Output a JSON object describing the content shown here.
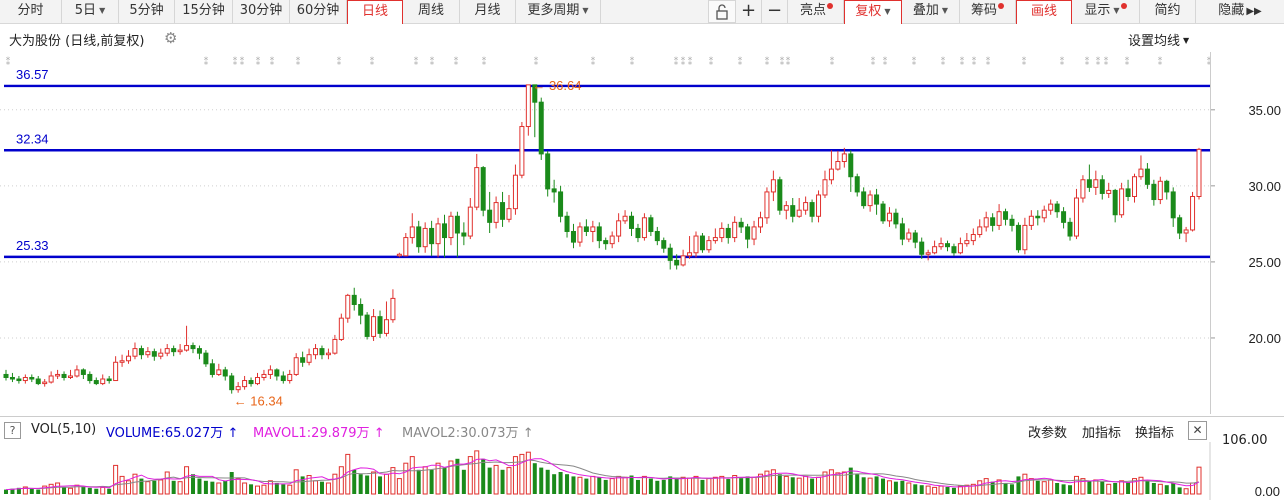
{
  "toolbar": {
    "tabs": [
      {
        "label": "分时"
      },
      {
        "label": "5日",
        "dropdown": true
      },
      {
        "label": "5分钟"
      },
      {
        "label": "15分钟"
      },
      {
        "label": "30分钟"
      },
      {
        "label": "60分钟"
      },
      {
        "label": "日线",
        "active": true
      },
      {
        "label": "周线"
      },
      {
        "label": "月线"
      },
      {
        "label": "更多周期",
        "dropdown": true
      }
    ],
    "tools": [
      {
        "label": "亮点",
        "dot": true
      },
      {
        "label": "复权",
        "dropdown": true
      },
      {
        "label": "叠加",
        "dropdown": true
      },
      {
        "label": "筹码",
        "dot": true
      },
      {
        "label": "画线"
      },
      {
        "label": "显示",
        "dropdown": true,
        "dot": true
      },
      {
        "label": "简约"
      },
      {
        "label": "隐藏"
      }
    ],
    "icons": [
      "lock-icon",
      "plus-icon",
      "minus-icon",
      "double-chevron-right-icon"
    ]
  },
  "header": {
    "title": "大为股份 (日线,前复权)",
    "ma_settings": "设置均线"
  },
  "price_axis": {
    "ticks": [
      "35.00",
      "30.00",
      "25.00",
      "20.00"
    ]
  },
  "hlines": [
    {
      "label": "36.57",
      "value": 36.57
    },
    {
      "label": "32.34",
      "value": 32.34
    },
    {
      "label": "25.33",
      "value": 25.33
    }
  ],
  "annotations": {
    "high": "← 36.64",
    "low": "← 16.34"
  },
  "volume": {
    "qmark": "?",
    "label": "VOL(5,10)",
    "volume": "VOLUME:65.027万",
    "mavol1": "MAVOL1:29.879万",
    "mavol2": "MAVOL2:30.073万",
    "axis_top": "106.00",
    "axis_bottom": "0.00",
    "links": [
      "改参数",
      "加指标",
      "换指标"
    ],
    "close": "✕"
  },
  "colors": {
    "up": "#e0312e",
    "down": "#1a8a1a",
    "hline": "#0000cc",
    "mavol1": "#e020e0",
    "mavol2": "#888888"
  },
  "chart_data": {
    "type": "candlestick",
    "ylim": [
      15,
      38.8
    ],
    "candles": [
      [
        17.6,
        17.4,
        17.9,
        17.2
      ],
      [
        17.4,
        17.3,
        17.7,
        17.1
      ],
      [
        17.3,
        17.2,
        17.5,
        17.0
      ],
      [
        17.2,
        17.4,
        17.6,
        17.0
      ],
      [
        17.4,
        17.3,
        17.6,
        17.1
      ],
      [
        17.3,
        17.0,
        17.5,
        16.9
      ],
      [
        17.0,
        17.1,
        17.3,
        16.8
      ],
      [
        17.1,
        17.5,
        17.8,
        17.0
      ],
      [
        17.5,
        17.6,
        17.9,
        17.3
      ],
      [
        17.6,
        17.4,
        17.8,
        17.2
      ],
      [
        17.4,
        17.5,
        17.9,
        17.3
      ],
      [
        17.5,
        17.9,
        18.2,
        17.4
      ],
      [
        17.9,
        17.6,
        18.0,
        17.3
      ],
      [
        17.6,
        17.2,
        17.8,
        17.0
      ],
      [
        17.2,
        17.0,
        17.4,
        16.9
      ],
      [
        17.0,
        17.3,
        17.6,
        16.9
      ],
      [
        17.3,
        17.2,
        17.5,
        17.0
      ],
      [
        17.2,
        18.4,
        18.8,
        17.2
      ],
      [
        18.4,
        18.5,
        18.9,
        18.1
      ],
      [
        18.5,
        18.8,
        19.2,
        18.3
      ],
      [
        18.8,
        19.3,
        19.7,
        18.6
      ],
      [
        19.3,
        18.9,
        19.5,
        18.6
      ],
      [
        18.9,
        19.1,
        19.4,
        18.7
      ],
      [
        19.1,
        18.8,
        19.3,
        18.5
      ],
      [
        18.8,
        19.0,
        19.3,
        18.6
      ],
      [
        19.0,
        19.3,
        19.6,
        18.8
      ],
      [
        19.3,
        19.1,
        19.5,
        18.8
      ],
      [
        19.1,
        19.2,
        19.6,
        18.9
      ],
      [
        19.2,
        19.5,
        20.8,
        19.1
      ],
      [
        19.5,
        19.3,
        19.7,
        19.0
      ],
      [
        19.3,
        19.0,
        19.5,
        18.6
      ],
      [
        19.0,
        18.3,
        19.2,
        18.1
      ],
      [
        18.3,
        17.6,
        18.6,
        17.4
      ],
      [
        17.6,
        17.9,
        18.3,
        17.5
      ],
      [
        17.9,
        17.5,
        18.1,
        17.2
      ],
      [
        17.5,
        16.6,
        17.7,
        16.34
      ],
      [
        16.6,
        16.8,
        17.1,
        16.4
      ],
      [
        16.8,
        17.2,
        17.5,
        16.6
      ],
      [
        17.2,
        17.0,
        17.4,
        16.8
      ],
      [
        17.0,
        17.4,
        17.7,
        16.9
      ],
      [
        17.4,
        17.6,
        17.9,
        17.2
      ],
      [
        17.6,
        17.9,
        18.2,
        17.3
      ],
      [
        17.9,
        17.5,
        18.0,
        17.2
      ],
      [
        17.5,
        17.2,
        17.8,
        17.0
      ],
      [
        17.2,
        17.6,
        17.9,
        17.0
      ],
      [
        17.6,
        18.7,
        19.0,
        17.5
      ],
      [
        18.7,
        18.4,
        19.1,
        18.1
      ],
      [
        18.4,
        18.9,
        19.3,
        18.2
      ],
      [
        18.9,
        19.3,
        19.6,
        18.6
      ],
      [
        19.3,
        18.9,
        19.5,
        18.6
      ],
      [
        18.9,
        19.0,
        19.3,
        18.6
      ],
      [
        19.0,
        19.9,
        20.2,
        18.9
      ],
      [
        19.9,
        21.3,
        21.6,
        19.8
      ],
      [
        21.3,
        22.8,
        22.9,
        21.0
      ],
      [
        22.8,
        22.2,
        23.3,
        21.8
      ],
      [
        22.2,
        21.5,
        22.6,
        20.9
      ],
      [
        21.5,
        20.1,
        21.7,
        19.9
      ],
      [
        20.1,
        21.4,
        21.9,
        19.8
      ],
      [
        21.4,
        20.3,
        21.8,
        20.0
      ],
      [
        20.3,
        21.2,
        22.4,
        20.1
      ],
      [
        21.2,
        22.6,
        23.2,
        21.0
      ],
      [
        25.4,
        25.5,
        25.6,
        25.3
      ],
      [
        25.4,
        26.6,
        26.9,
        25.4
      ],
      [
        26.6,
        27.3,
        28.2,
        26.2
      ],
      [
        27.3,
        26.0,
        27.7,
        25.6
      ],
      [
        26.0,
        27.2,
        27.6,
        25.6
      ],
      [
        27.2,
        26.2,
        27.7,
        25.4
      ],
      [
        26.2,
        27.5,
        27.9,
        25.3
      ],
      [
        27.5,
        26.6,
        28.1,
        25.3
      ],
      [
        26.6,
        28.0,
        28.3,
        26.1
      ],
      [
        28.0,
        26.9,
        28.3,
        25.3
      ],
      [
        26.9,
        26.7,
        27.6,
        26.1
      ],
      [
        26.7,
        28.6,
        29.2,
        26.5
      ],
      [
        28.6,
        31.2,
        32.1,
        28.4
      ],
      [
        31.2,
        28.4,
        31.3,
        28.0
      ],
      [
        28.4,
        27.6,
        29.6,
        26.9
      ],
      [
        27.6,
        28.9,
        29.3,
        27.2
      ],
      [
        28.9,
        27.8,
        29.6,
        27.3
      ],
      [
        27.8,
        28.5,
        29.4,
        27.6
      ],
      [
        28.5,
        30.7,
        31.4,
        28.1
      ],
      [
        30.7,
        33.9,
        34.2,
        30.5
      ],
      [
        33.9,
        36.64,
        36.64,
        33.3
      ],
      [
        36.64,
        35.5,
        36.3,
        33.2
      ],
      [
        35.5,
        32.1,
        35.8,
        31.7
      ],
      [
        32.1,
        29.8,
        32.3,
        29.3
      ],
      [
        29.8,
        29.6,
        30.4,
        28.9
      ],
      [
        29.6,
        28.0,
        30.0,
        27.6
      ],
      [
        28.0,
        27.0,
        28.3,
        26.6
      ],
      [
        27.0,
        26.3,
        27.5,
        25.9
      ],
      [
        26.3,
        27.3,
        27.6,
        26.0
      ],
      [
        27.3,
        27.0,
        27.8,
        26.7
      ],
      [
        27.0,
        27.3,
        27.7,
        26.3
      ],
      [
        27.3,
        26.4,
        27.6,
        25.9
      ],
      [
        26.4,
        26.2,
        26.6,
        25.8
      ],
      [
        26.2,
        26.7,
        27.0,
        25.9
      ],
      [
        26.7,
        27.7,
        28.2,
        26.3
      ],
      [
        27.7,
        28.0,
        28.4,
        27.5
      ],
      [
        28.0,
        27.2,
        28.3,
        26.7
      ],
      [
        27.2,
        26.6,
        27.5,
        26.3
      ],
      [
        26.6,
        27.9,
        28.2,
        26.4
      ],
      [
        27.9,
        27.0,
        28.1,
        26.7
      ],
      [
        27.0,
        26.4,
        27.3,
        26.1
      ],
      [
        26.4,
        25.9,
        26.6,
        25.6
      ],
      [
        25.9,
        25.1,
        26.2,
        24.5
      ],
      [
        25.1,
        24.8,
        25.5,
        24.5
      ],
      [
        24.8,
        25.4,
        25.8,
        24.7
      ],
      [
        25.4,
        25.6,
        26.7,
        25.2
      ],
      [
        25.6,
        26.7,
        27.0,
        25.3
      ],
      [
        26.7,
        25.8,
        26.9,
        25.6
      ],
      [
        25.8,
        26.4,
        26.7,
        25.6
      ],
      [
        26.4,
        26.6,
        27.2,
        26.2
      ],
      [
        26.6,
        27.2,
        27.6,
        26.3
      ],
      [
        27.2,
        26.6,
        27.5,
        26.2
      ],
      [
        26.6,
        27.6,
        28.0,
        26.3
      ],
      [
        27.6,
        27.3,
        27.9,
        26.9
      ],
      [
        27.3,
        26.5,
        27.5,
        25.9
      ],
      [
        26.5,
        27.3,
        27.7,
        26.1
      ],
      [
        27.3,
        27.9,
        28.3,
        26.9
      ],
      [
        27.9,
        29.6,
        29.9,
        27.5
      ],
      [
        29.6,
        30.4,
        31.0,
        29.0
      ],
      [
        30.4,
        28.4,
        30.6,
        28.1
      ],
      [
        28.4,
        28.7,
        29.0,
        27.8
      ],
      [
        28.7,
        28.0,
        29.2,
        27.6
      ],
      [
        28.0,
        28.4,
        29.2,
        27.9
      ],
      [
        28.4,
        28.9,
        29.3,
        28.1
      ],
      [
        28.9,
        28.0,
        29.1,
        27.6
      ],
      [
        28.0,
        29.4,
        29.7,
        27.6
      ],
      [
        29.4,
        30.4,
        31.0,
        29.2
      ],
      [
        30.4,
        31.1,
        32.34,
        30.1
      ],
      [
        31.1,
        31.6,
        32.3,
        31.0
      ],
      [
        31.6,
        32.1,
        32.5,
        31.2
      ],
      [
        32.1,
        30.6,
        32.34,
        29.6
      ],
      [
        30.6,
        29.6,
        30.8,
        29.3
      ],
      [
        29.6,
        28.7,
        29.9,
        28.5
      ],
      [
        28.7,
        29.4,
        29.7,
        28.3
      ],
      [
        29.4,
        28.8,
        29.8,
        28.1
      ],
      [
        28.8,
        27.7,
        29.0,
        27.5
      ],
      [
        27.7,
        28.2,
        28.6,
        27.3
      ],
      [
        28.2,
        27.5,
        28.5,
        27.2
      ],
      [
        27.5,
        26.5,
        27.9,
        26.1
      ],
      [
        26.5,
        26.9,
        27.2,
        26.3
      ],
      [
        26.9,
        26.3,
        27.1,
        25.9
      ],
      [
        26.3,
        25.5,
        26.6,
        25.2
      ],
      [
        25.5,
        25.6,
        25.8,
        25.1
      ],
      [
        25.6,
        26.0,
        26.4,
        25.5
      ],
      [
        26.0,
        26.2,
        26.6,
        25.8
      ],
      [
        26.2,
        26.0,
        26.4,
        25.7
      ],
      [
        26.0,
        25.6,
        26.2,
        25.4
      ],
      [
        25.6,
        26.2,
        26.6,
        25.5
      ],
      [
        26.2,
        26.4,
        26.9,
        26.0
      ],
      [
        26.4,
        26.8,
        27.2,
        26.1
      ],
      [
        26.8,
        27.3,
        27.8,
        26.6
      ],
      [
        27.3,
        27.9,
        28.3,
        27.0
      ],
      [
        27.9,
        27.4,
        28.2,
        27.0
      ],
      [
        27.4,
        28.3,
        28.8,
        27.1
      ],
      [
        28.3,
        27.8,
        28.5,
        27.4
      ],
      [
        27.8,
        27.4,
        28.1,
        27.0
      ],
      [
        27.4,
        25.8,
        27.6,
        25.6
      ],
      [
        25.8,
        27.4,
        27.9,
        25.5
      ],
      [
        27.4,
        28.0,
        28.4,
        27.1
      ],
      [
        28.0,
        27.9,
        28.4,
        27.4
      ],
      [
        27.9,
        28.4,
        28.7,
        27.6
      ],
      [
        28.4,
        28.8,
        29.1,
        28.1
      ],
      [
        28.8,
        28.3,
        29.0,
        27.9
      ],
      [
        28.3,
        27.6,
        28.6,
        27.2
      ],
      [
        27.6,
        26.7,
        27.9,
        26.4
      ],
      [
        26.7,
        29.2,
        29.8,
        26.5
      ],
      [
        29.2,
        30.4,
        30.7,
        28.9
      ],
      [
        30.4,
        29.9,
        31.4,
        29.6
      ],
      [
        29.9,
        30.4,
        31.0,
        29.4
      ],
      [
        30.4,
        29.5,
        30.7,
        29.1
      ],
      [
        29.5,
        29.7,
        30.2,
        29.2
      ],
      [
        29.7,
        28.1,
        29.8,
        27.6
      ],
      [
        28.1,
        29.8,
        30.2,
        27.9
      ],
      [
        29.8,
        29.3,
        30.4,
        29.0
      ],
      [
        29.3,
        30.6,
        30.8,
        28.9
      ],
      [
        30.6,
        31.1,
        32.0,
        30.4
      ],
      [
        31.1,
        30.1,
        31.5,
        29.8
      ],
      [
        30.1,
        29.1,
        30.4,
        28.7
      ],
      [
        29.1,
        30.3,
        30.6,
        28.8
      ],
      [
        30.3,
        29.6,
        30.4,
        29.1
      ],
      [
        29.6,
        27.9,
        29.9,
        27.3
      ],
      [
        27.9,
        26.9,
        28.1,
        26.5
      ],
      [
        26.9,
        27.1,
        27.3,
        26.3
      ],
      [
        27.1,
        29.3,
        29.6,
        27.0
      ],
      [
        29.3,
        32.4,
        32.5,
        29.1
      ]
    ],
    "volume": [
      0.1,
      0.12,
      0.14,
      0.16,
      0.12,
      0.1,
      0.18,
      0.22,
      0.25,
      0.15,
      0.13,
      0.2,
      0.18,
      0.14,
      0.12,
      0.15,
      0.12,
      0.65,
      0.4,
      0.3,
      0.45,
      0.35,
      0.28,
      0.3,
      0.32,
      0.5,
      0.3,
      0.28,
      0.62,
      0.45,
      0.35,
      0.3,
      0.28,
      0.25,
      0.3,
      0.5,
      0.35,
      0.25,
      0.22,
      0.18,
      0.2,
      0.3,
      0.25,
      0.22,
      0.2,
      0.55,
      0.4,
      0.42,
      0.3,
      0.28,
      0.25,
      0.45,
      0.62,
      0.9,
      0.55,
      0.45,
      0.42,
      0.5,
      0.4,
      0.45,
      0.6,
      0.35,
      0.7,
      0.85,
      0.55,
      0.62,
      0.55,
      0.7,
      0.6,
      0.75,
      0.8,
      0.55,
      0.85,
      0.98,
      0.8,
      0.6,
      0.65,
      0.55,
      0.6,
      0.85,
      0.9,
      0.95,
      0.7,
      0.6,
      0.55,
      0.45,
      0.5,
      0.45,
      0.4,
      0.38,
      0.35,
      0.4,
      0.38,
      0.32,
      0.35,
      0.4,
      0.38,
      0.42,
      0.32,
      0.4,
      0.35,
      0.3,
      0.32,
      0.4,
      0.35,
      0.38,
      0.36,
      0.4,
      0.32,
      0.35,
      0.38,
      0.4,
      0.34,
      0.42,
      0.36,
      0.4,
      0.38,
      0.45,
      0.52,
      0.55,
      0.45,
      0.4,
      0.38,
      0.36,
      0.4,
      0.35,
      0.38,
      0.5,
      0.55,
      0.48,
      0.5,
      0.6,
      0.45,
      0.38,
      0.36,
      0.4,
      0.35,
      0.3,
      0.28,
      0.3,
      0.25,
      0.22,
      0.2,
      0.18,
      0.15,
      0.18,
      0.16,
      0.14,
      0.18,
      0.2,
      0.22,
      0.3,
      0.35,
      0.28,
      0.32,
      0.25,
      0.22,
      0.4,
      0.45,
      0.35,
      0.3,
      0.28,
      0.32,
      0.25,
      0.22,
      0.2,
      0.4,
      0.35,
      0.3,
      0.32,
      0.28,
      0.22,
      0.25,
      0.3,
      0.26,
      0.35,
      0.38,
      0.3,
      0.25,
      0.22,
      0.2,
      0.25,
      0.15,
      0.12,
      0.25,
      0.61
    ],
    "vol_ylim": [
      0,
      106
    ]
  }
}
